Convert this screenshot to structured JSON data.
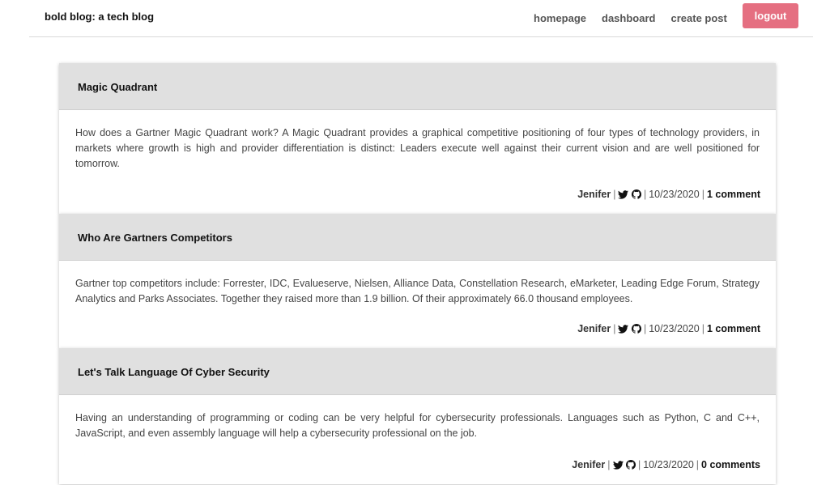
{
  "header": {
    "brand": "bold blog: a tech blog",
    "nav": [
      {
        "label": "homepage"
      },
      {
        "label": "dashboard"
      },
      {
        "label": "create post"
      }
    ],
    "logout_label": "logout",
    "logout_color": "#e56f81"
  },
  "posts": [
    {
      "title": "Magic Quadrant",
      "content": "How does a Gartner Magic Quadrant work? A Magic Quadrant provides a graphical competitive positioning of four types of technology providers, in markets where growth is high and provider differentiation is distinct: Leaders execute well against their current vision and are well positioned for tomorrow.",
      "author": "Jenifer",
      "date": "10/23/2020",
      "comments": "1 comment"
    },
    {
      "title": "Who Are Gartners Competitors",
      "content": "Gartner top competitors include: Forrester, IDC, Evalueserve, Nielsen, Alliance Data, Constellation Research, eMarketer, Leading Edge Forum, Strategy Analytics and Parks Associates. Together they raised more than 1.9 billion. Of their approximately 66.0 thousand employees.",
      "author": "Jenifer",
      "date": "10/23/2020",
      "comments": "1 comment"
    },
    {
      "title": "Let's Talk Language Of Cyber Security",
      "content": "Having an understanding of programming or coding can be very helpful for cybersecurity professionals. Languages such as Python, C and C++, JavaScript, and even assembly language will help a cybersecurity professional on the job.",
      "author": "Jenifer",
      "date": "10/23/2020",
      "comments": "0 comments"
    }
  ],
  "icons": {
    "twitter": "twitter-icon",
    "github": "github-icon"
  },
  "colors": {
    "post_header_bg": "#e0e0e0"
  }
}
